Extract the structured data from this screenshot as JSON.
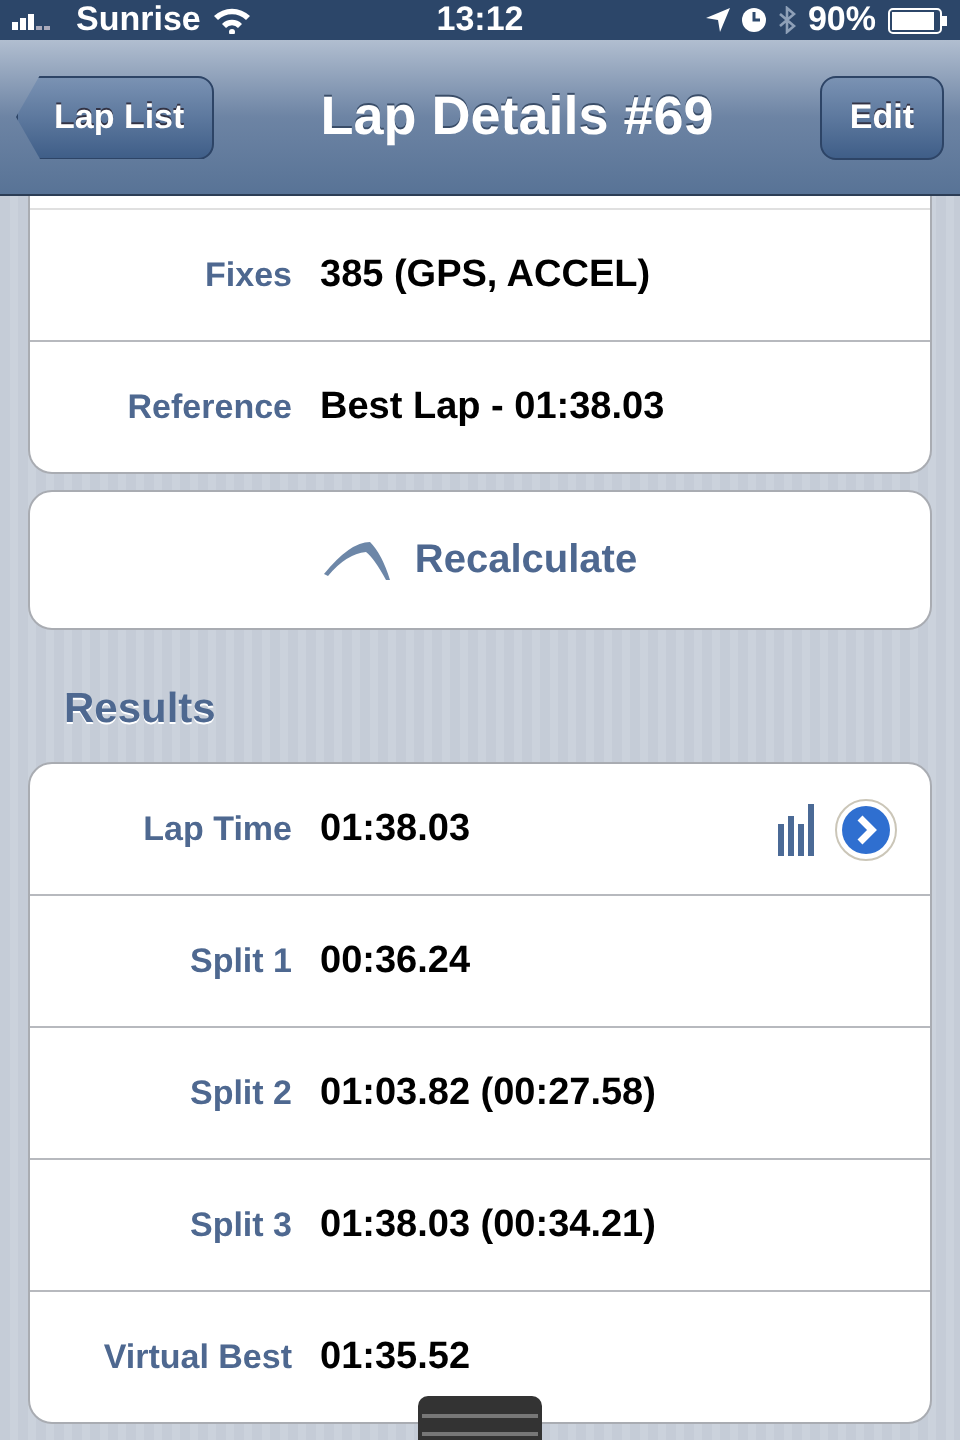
{
  "status_bar": {
    "carrier": "Sunrise",
    "time": "13:12",
    "battery": "90%"
  },
  "nav_bar": {
    "back": "Lap List",
    "title": "Lap Details #69",
    "action": "Edit"
  },
  "details": [
    {
      "label": "Fixes",
      "value": "385 (GPS, ACCEL)"
    },
    {
      "label": "Reference",
      "value": "Best Lap - 01:38.03"
    }
  ],
  "recalculate_button": "Recalculate",
  "results": {
    "header": "Results",
    "rows": [
      {
        "kind": "chart",
        "label": "Lap Time",
        "value": "01:38.03"
      },
      {
        "kind": "plain",
        "label": "Split 1",
        "value": "00:36.24"
      },
      {
        "kind": "plain",
        "label": "Split 2",
        "value": "01:03.82 (00:27.58)"
      },
      {
        "kind": "plain",
        "label": "Split 3",
        "value": "01:38.03 (00:34.21)"
      },
      {
        "kind": "plain",
        "label": "Virtual Best",
        "value": "01:35.52"
      }
    ]
  }
}
